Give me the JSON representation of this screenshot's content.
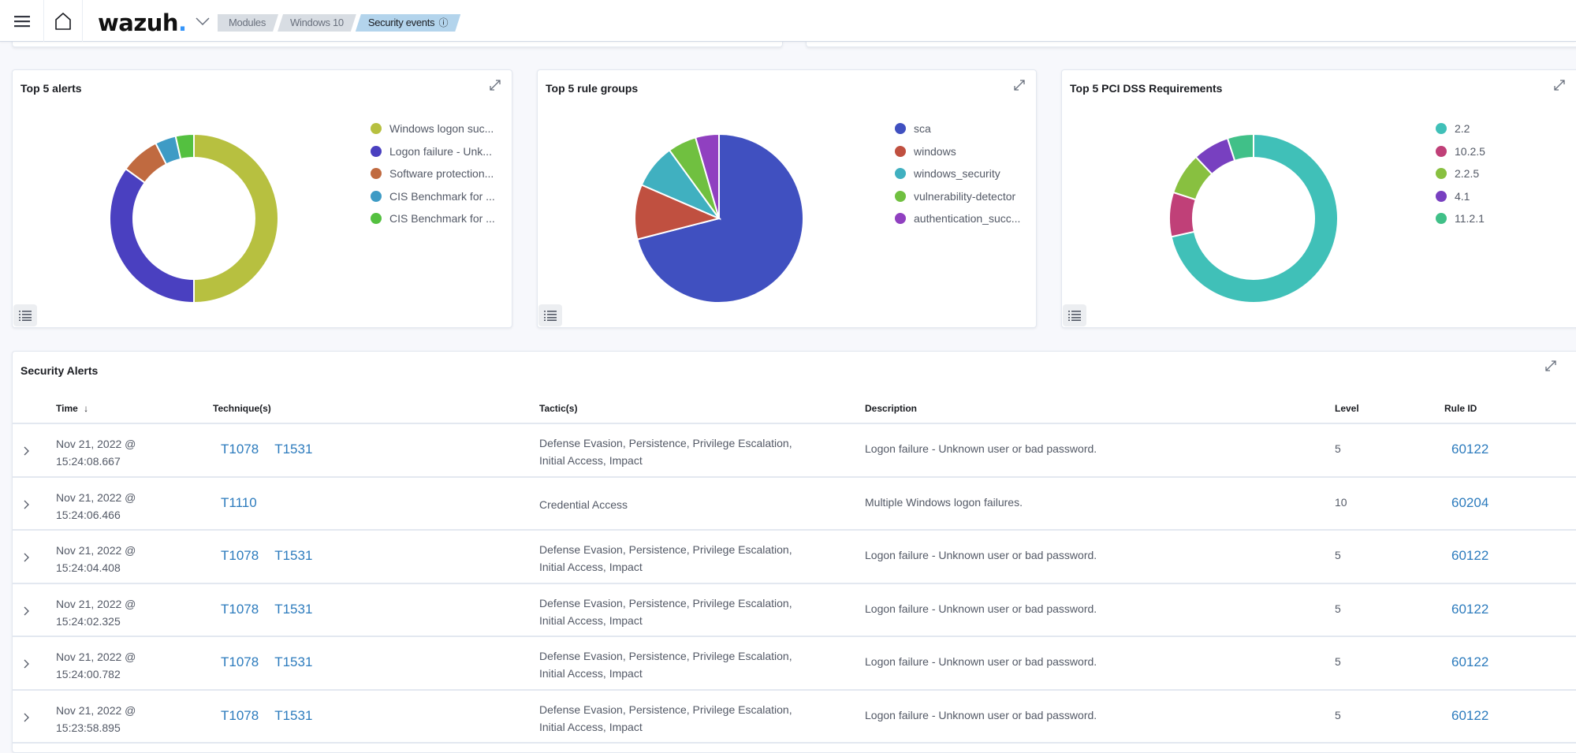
{
  "header": {
    "logo_text": "wazuh",
    "logo_dot": ".",
    "breadcrumbs": [
      {
        "label": "Modules"
      },
      {
        "label": "Windows 10"
      },
      {
        "label": "Security events",
        "info_icon": "ⓘ"
      }
    ]
  },
  "panels": [
    {
      "title": "Top 5 alerts",
      "chart_type": "donut",
      "legend": [
        {
          "label": "Windows logon suc...",
          "color": "#b7c040"
        },
        {
          "label": "Logon failure - Unk...",
          "color": "#4a40c0"
        },
        {
          "label": "Software protection...",
          "color": "#c06a40"
        },
        {
          "label": "CIS Benchmark for ...",
          "color": "#3e9bc5"
        },
        {
          "label": "CIS Benchmark for ...",
          "color": "#54c040"
        }
      ]
    },
    {
      "title": "Top 5 rule groups",
      "chart_type": "pie",
      "legend": [
        {
          "label": "sca",
          "color": "#4050c0"
        },
        {
          "label": "windows",
          "color": "#c05040"
        },
        {
          "label": "windows_security",
          "color": "#40b0c0"
        },
        {
          "label": "vulnerability-detector",
          "color": "#70c040"
        },
        {
          "label": "authentication_succ...",
          "color": "#9040c0"
        }
      ]
    },
    {
      "title": "Top 5 PCI DSS Requirements",
      "chart_type": "donut",
      "legend": [
        {
          "label": "2.2",
          "color": "#40c0b8"
        },
        {
          "label": "10.2.5",
          "color": "#c04078"
        },
        {
          "label": "2.2.5",
          "color": "#88c040"
        },
        {
          "label": "4.1",
          "color": "#7840c0"
        },
        {
          "label": "11.2.1",
          "color": "#40c088"
        }
      ]
    }
  ],
  "chart_data": [
    {
      "type": "pie",
      "title": "Top 5 alerts",
      "donut": true,
      "legend_position": "right",
      "categories": [
        "Windows logon suc...",
        "Logon failure - Unk...",
        "Software protection...",
        "CIS Benchmark for ...",
        "CIS Benchmark for ..."
      ],
      "values": [
        50,
        35,
        7.5,
        4,
        3.5
      ],
      "colors": [
        "#b7c040",
        "#4a40c0",
        "#c06a40",
        "#3e9bc5",
        "#54c040"
      ]
    },
    {
      "type": "pie",
      "title": "Top 5 rule groups",
      "donut": false,
      "legend_position": "right",
      "categories": [
        "sca",
        "windows",
        "windows_security",
        "vulnerability-detector",
        "authentication_succ..."
      ],
      "values": [
        71,
        10.5,
        8.5,
        5.5,
        4.5
      ],
      "colors": [
        "#4050c0",
        "#c05040",
        "#40b0c0",
        "#70c040",
        "#9040c0"
      ]
    },
    {
      "type": "pie",
      "title": "Top 5 PCI DSS Requirements",
      "donut": true,
      "legend_position": "right",
      "categories": [
        "2.2",
        "10.2.5",
        "2.2.5",
        "4.1",
        "11.2.1"
      ],
      "values": [
        71.5,
        8.5,
        8,
        7,
        5
      ],
      "colors": [
        "#40c0b8",
        "#c04078",
        "#88c040",
        "#7840c0",
        "#40c088"
      ]
    }
  ],
  "alerts": {
    "title": "Security Alerts",
    "columns": {
      "time": "Time",
      "sort_icon": "↓",
      "technique": "Technique(s)",
      "tactic": "Tactic(s)",
      "description": "Description",
      "level": "Level",
      "rule_id": "Rule ID"
    },
    "rows": [
      {
        "date": "Nov 21, 2022 @",
        "time": "15:24:08.667",
        "techniques": [
          "T1078",
          "T1531"
        ],
        "tactics_line1": "Defense Evasion, Persistence, Privilege Escalation,",
        "tactics_line2": "Initial Access, Impact",
        "description": "Logon failure - Unknown user or bad password.",
        "level": "5",
        "rule_id": "60122"
      },
      {
        "date": "Nov 21, 2022 @",
        "time": "15:24:06.466",
        "techniques": [
          "T1110"
        ],
        "tactics_line1": "Credential Access",
        "tactics_line2": "",
        "description": "Multiple Windows logon failures.",
        "level": "10",
        "rule_id": "60204"
      },
      {
        "date": "Nov 21, 2022 @",
        "time": "15:24:04.408",
        "techniques": [
          "T1078",
          "T1531"
        ],
        "tactics_line1": "Defense Evasion, Persistence, Privilege Escalation,",
        "tactics_line2": "Initial Access, Impact",
        "description": "Logon failure - Unknown user or bad password.",
        "level": "5",
        "rule_id": "60122"
      },
      {
        "date": "Nov 21, 2022 @",
        "time": "15:24:02.325",
        "techniques": [
          "T1078",
          "T1531"
        ],
        "tactics_line1": "Defense Evasion, Persistence, Privilege Escalation,",
        "tactics_line2": "Initial Access, Impact",
        "description": "Logon failure - Unknown user or bad password.",
        "level": "5",
        "rule_id": "60122"
      },
      {
        "date": "Nov 21, 2022 @",
        "time": "15:24:00.782",
        "techniques": [
          "T1078",
          "T1531"
        ],
        "tactics_line1": "Defense Evasion, Persistence, Privilege Escalation,",
        "tactics_line2": "Initial Access, Impact",
        "description": "Logon failure - Unknown user or bad password.",
        "level": "5",
        "rule_id": "60122"
      },
      {
        "date": "Nov 21, 2022 @",
        "time": "15:23:58.895",
        "techniques": [
          "T1078",
          "T1531"
        ],
        "tactics_line1": "Defense Evasion, Persistence, Privilege Escalation,",
        "tactics_line2": "Initial Access, Impact",
        "description": "Logon failure - Unknown user or bad password.",
        "level": "5",
        "rule_id": "60122"
      }
    ]
  }
}
